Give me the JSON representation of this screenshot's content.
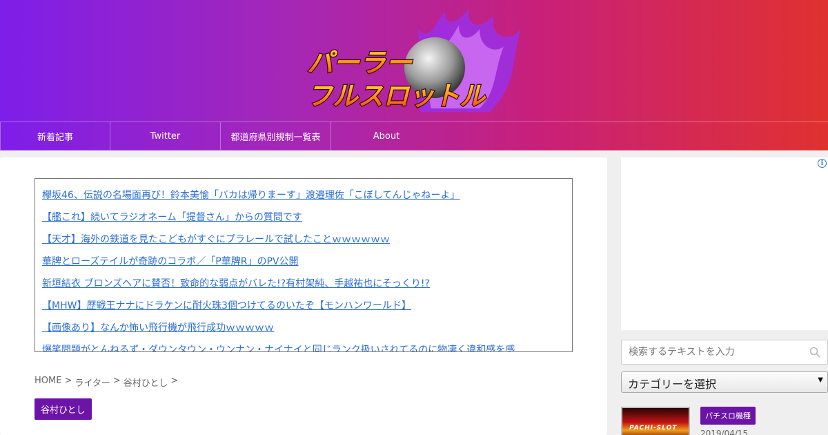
{
  "logo": {
    "line1": "パーラー",
    "line2": "フルスロットル"
  },
  "nav": {
    "items": [
      {
        "label": "新着記事"
      },
      {
        "label": "Twitter"
      },
      {
        "label": "都道府県別規制一覧表"
      },
      {
        "label": "About"
      }
    ]
  },
  "links": [
    "欅坂46、伝説の名場面再び！鈴本美愉「バカは帰りまーす」渡邉理佐「こぼしてんじゃねーよ」",
    "【艦これ】続いてラジオネーム「提督さん」からの質問です",
    "【天才】海外の鉄道を見たこどもがすぐにプラレールで試したことｗｗｗｗｗｗ",
    "華牌とローズテイルが奇跡のコラボ／「P華牌R」のPV公開",
    "新垣結衣 ブロンズヘアに賛否！致命的な弱点がバレた!?有村架純、手越祐也にそっくり!?",
    "【MHW】歴戦王ナナにドラケンに耐火珠3個つけてるのいたぞ【モンハンワールド】",
    "【画像あり】なんか怖い飛行機が飛行成功ｗｗｗｗｗ",
    "爆笑問題がとんねるず・ダウンタウン・ウンナン・ナイナイと同じランク扱いされてるのに物凄く違和感を感"
  ],
  "breadcrumb": {
    "home": "HOME",
    "sep": ">",
    "level1": "ライター",
    "level2": "谷村ひとし"
  },
  "author": {
    "name": "谷村ひとし"
  },
  "sidebar": {
    "ad_info": "i",
    "search": {
      "placeholder": "検索するテキストを入力"
    },
    "category": {
      "selected": "カテゴリーを選択",
      "arrow": "▼"
    },
    "post": {
      "thumb_text": "PACHI-SLOT",
      "tag": "パチスロ機種",
      "date": "2019/04/15"
    }
  },
  "colors": {
    "accent": "#6d14a8",
    "link": "#2b6fd6",
    "header_left": "#7e1ee9",
    "header_right": "#e0312f"
  }
}
